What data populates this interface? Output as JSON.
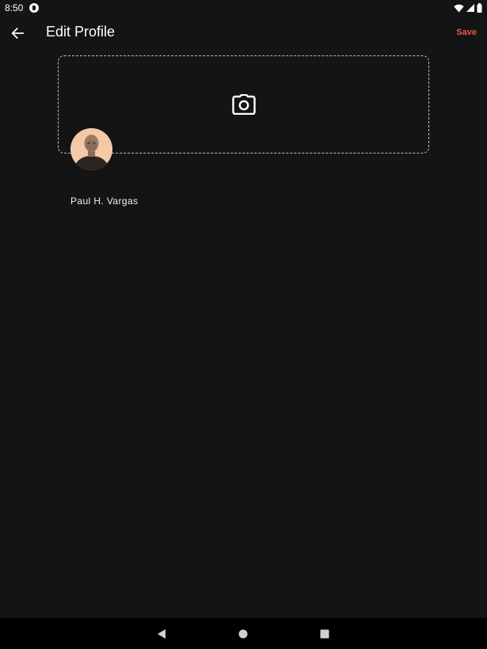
{
  "status_bar": {
    "time": "8:50",
    "icons": [
      "app-notification-icon",
      "wifi-icon",
      "cell-signal-icon",
      "battery-icon"
    ]
  },
  "app_bar": {
    "title": "Edit Profile",
    "back_icon": "arrow-back-icon",
    "save_label": "Save"
  },
  "banner": {
    "icon": "camera-icon"
  },
  "profile": {
    "name": "Paul H. Vargas"
  },
  "nav_bar": {
    "icons": [
      "nav-back-icon",
      "nav-home-icon",
      "nav-recents-icon"
    ]
  },
  "colors": {
    "background": "#141414",
    "accent": "#e8574f",
    "nav_background": "#000000",
    "dashed_border": "#bdbdbd"
  }
}
